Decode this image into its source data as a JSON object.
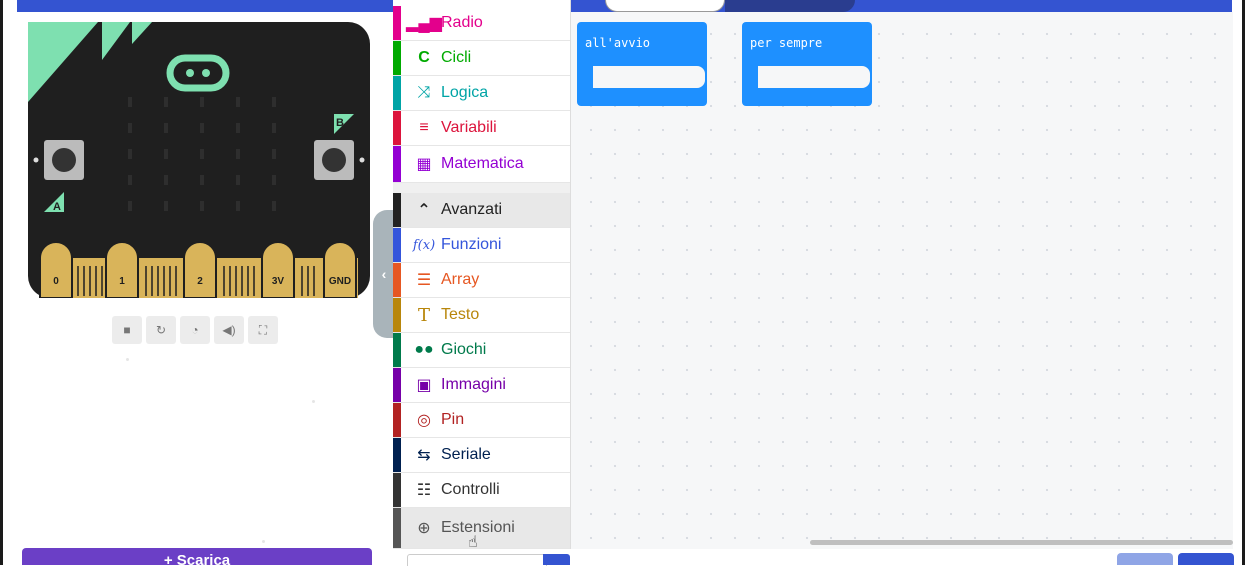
{
  "toolbox": {
    "items": [
      {
        "label": "Radio",
        "color": "#E3008C",
        "icon": "signal-icon",
        "glyph": "📶"
      },
      {
        "label": "Cicli",
        "color": "#00AA00",
        "icon": "loop-icon",
        "glyph": "↻"
      },
      {
        "label": "Logica",
        "color": "#00A4A6",
        "icon": "shuffle-icon",
        "glyph": "⤨"
      },
      {
        "label": "Variabili",
        "color": "#DC143C",
        "icon": "list-icon",
        "glyph": "≡"
      },
      {
        "label": "Matematica",
        "color": "#9400D3",
        "icon": "calculator-icon",
        "glyph": "▦"
      }
    ],
    "advanced": {
      "label": "Avanzati",
      "icon": "chevron-up-icon",
      "glyph": "⌃"
    },
    "advanced_items": [
      {
        "label": "Funzioni",
        "color": "#3455DB",
        "icon": "function-icon",
        "glyph": "ƒ"
      },
      {
        "label": "Array",
        "color": "#E65722",
        "icon": "array-icon",
        "glyph": "☰"
      },
      {
        "label": "Testo",
        "color": "#B8860B",
        "icon": "text-icon",
        "glyph": "T"
      },
      {
        "label": "Giochi",
        "color": "#007A4B",
        "icon": "gamepad-icon",
        "glyph": "🎮"
      },
      {
        "label": "Immagini",
        "color": "#7600A8",
        "icon": "image-icon",
        "glyph": "▣"
      },
      {
        "label": "Pin",
        "color": "#B22222",
        "icon": "target-icon",
        "glyph": "◎"
      },
      {
        "label": "Seriale",
        "color": "#002050",
        "icon": "usb-icon",
        "glyph": "⇆"
      },
      {
        "label": "Controlli",
        "color": "#333333",
        "icon": "server-icon",
        "glyph": "☷"
      },
      {
        "label": "Estensioni",
        "color": "#555555",
        "icon": "plus-circle-icon",
        "glyph": "⊕"
      }
    ]
  },
  "workspace": {
    "blocks": [
      {
        "label": "all'avvio"
      },
      {
        "label": "per sempre"
      }
    ]
  },
  "board": {
    "pins": [
      "0",
      "1",
      "2",
      "3V",
      "GND"
    ],
    "button_a": "A",
    "button_b": "B"
  },
  "download": {
    "label": "+ Scarica"
  }
}
